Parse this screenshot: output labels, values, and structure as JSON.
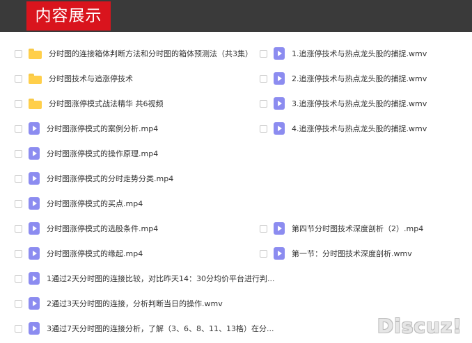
{
  "header": {
    "title": "内容展示"
  },
  "watermark": "Discuz!",
  "left_column": [
    {
      "type": "folder",
      "name": "分时图的连接箱体判断方法和分时图的箱体预测法（共3集）"
    },
    {
      "type": "folder",
      "name": "分时图技术与追涨停技术"
    },
    {
      "type": "folder",
      "name": "分时图涨停模式战法精华 共6视频"
    },
    {
      "type": "file",
      "name": "分时图涨停模式的案例分析.mp4"
    },
    {
      "type": "file",
      "name": "分时图涨停模式的操作原理.mp4"
    },
    {
      "type": "file",
      "name": "分时图涨停模式的分时走势分类.mp4"
    },
    {
      "type": "file",
      "name": "分时图涨停模式的买点.mp4"
    },
    {
      "type": "file",
      "name": "分时图涨停模式的选股条件.mp4"
    },
    {
      "type": "file",
      "name": "分时图涨停模式的缘起.mp4"
    },
    {
      "type": "file",
      "name": "1通过2天分时图的连接比较，对比昨天14：30分均价平台进行判..."
    },
    {
      "type": "file",
      "name": "2通过3天分时图的连接，分析判断当日的操作.wmv"
    },
    {
      "type": "file",
      "name": "3通过7天分时图的连接分析，了解（3、6、8、11、13格）在分..."
    }
  ],
  "right_column_top": [
    {
      "type": "file",
      "name": "1.追涨停技术与热点龙头股的捕捉.wmv"
    },
    {
      "type": "file",
      "name": "2.追涨停技术与热点龙头股的捕捉.wmv"
    },
    {
      "type": "file",
      "name": "3.追涨停技术与热点龙头股的捕捉.wmv"
    },
    {
      "type": "file",
      "name": "4.追涨停技术与热点龙头股的捕捉.wmv"
    }
  ],
  "right_column_bottom": [
    {
      "type": "file",
      "name": "第四节分时图技术深度剖析（2）.mp4"
    },
    {
      "type": "file",
      "name": "第一节：分时图技术深度剖析.wmv"
    }
  ]
}
